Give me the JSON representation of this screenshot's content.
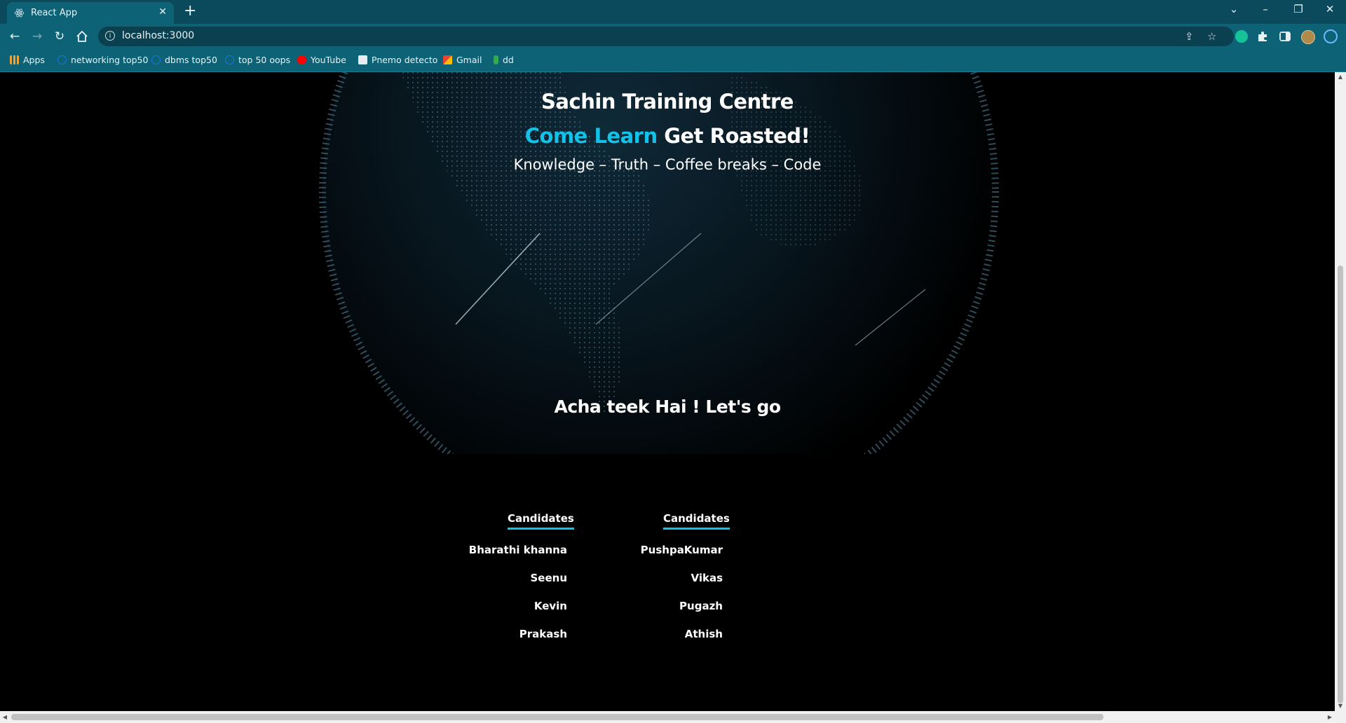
{
  "browser": {
    "tab_title": "React App",
    "tab_close": "✕",
    "new_tab": "+",
    "url": "localhost:3000",
    "window_controls": {
      "tab_search": "⌄",
      "minimize": "–",
      "restore": "❐",
      "close": "✕"
    },
    "bookmarks": [
      {
        "label": "Apps",
        "icon": "apps-grid-icon",
        "color": "#e8a33d"
      },
      {
        "label": "networking top50",
        "icon": "globe-icon",
        "color": "#1a73e8"
      },
      {
        "label": "dbms top50",
        "icon": "globe-icon",
        "color": "#1a73e8"
      },
      {
        "label": "top 50 oops",
        "icon": "globe-icon",
        "color": "#1a73e8"
      },
      {
        "label": "YouTube",
        "icon": "youtube-icon",
        "color": "#ff0000"
      },
      {
        "label": "Pnemo detecto",
        "icon": "document-icon",
        "color": "#e8eaed"
      },
      {
        "label": "Gmail",
        "icon": "gmail-icon",
        "color": "#ea4335"
      },
      {
        "label": "dd",
        "icon": "g-letter-icon",
        "color": "#34a853"
      }
    ]
  },
  "hero": {
    "title": "Sachin Training Centre",
    "tagline_accent": "Come Learn",
    "tagline_rest": " Get Roasted!",
    "subtitle": "Knowledge – Truth – Coffee breaks – Code",
    "cta": "Acha teek Hai ! Let's go",
    "accent_color": "#12c2e9"
  },
  "candidates": {
    "columns": [
      {
        "heading": "Candidates",
        "names": [
          "Bharathi khanna",
          "Seenu",
          "Kevin",
          "Prakash"
        ]
      },
      {
        "heading": "Candidates",
        "names": [
          "PushpaKumar",
          "Vikas",
          "Pugazh",
          "Athish"
        ]
      }
    ]
  }
}
